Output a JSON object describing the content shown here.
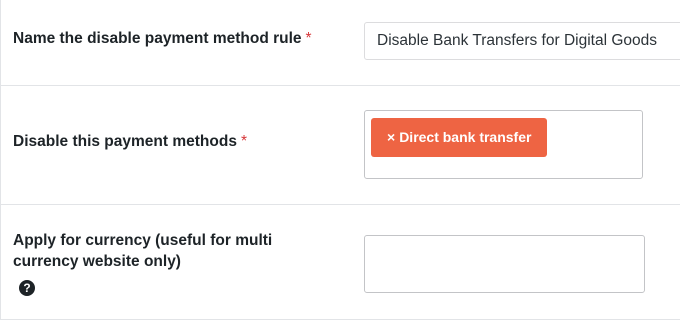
{
  "rule_name": {
    "label": "Name the disable payment method rule",
    "required_mark": "*",
    "value": "Disable Bank Transfers for Digital Goods"
  },
  "payment_methods": {
    "label": "Disable this payment methods",
    "required_mark": "*",
    "selected": [
      {
        "remove_glyph": "×",
        "label": "Direct bank transfer"
      }
    ]
  },
  "currency": {
    "label": "Apply for currency (useful for multi currency website only)",
    "help_glyph": "?",
    "value": ""
  },
  "colors": {
    "tag_background": "#ee6443",
    "required": "#d63638"
  }
}
